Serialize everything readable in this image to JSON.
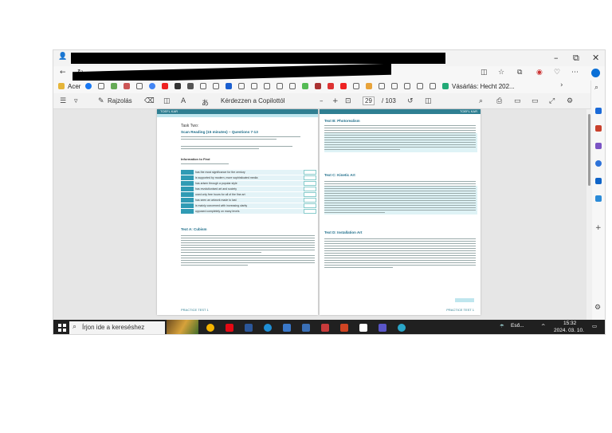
{
  "browser": {
    "bookmarks": {
      "first_label": "Acer",
      "last_label": "Vásárlás: Hecht 202..."
    },
    "pdf_toolbar": {
      "draw_label": "Rajzolás",
      "copilot_placeholder": "Kérdezzen a Copilottól",
      "current_page": "29",
      "total_pages": "/ 103"
    }
  },
  "document": {
    "left_page": {
      "header_tab": "TOEFL KAR",
      "task_title": "Task Two:",
      "subtitle": "Scan Reading (15 minutes) – Questions 7-13",
      "info_heading": "Information to Find",
      "rows": [
        "has the most significance for the century",
        "is supported by modern, more sophisticated media",
        "has arisen through a popular style",
        "has revolutionised art and society",
        "used only free hours for all of the fine art",
        "has seen an artwork made to last",
        "is mainly concerned with increasing clarity",
        "opposed completely on many levels"
      ],
      "text_a_heading": "Text A: Cubism",
      "footer": "PRACTICE TEST 1"
    },
    "right_page": {
      "header_tab": "TOEFL KAR",
      "text_b_heading": "Text B: Photorealism",
      "text_c_heading": "Text C: Kinetic Art",
      "text_d_heading": "Text D: Installation Art",
      "footer": "PRACTICE TEST 1"
    }
  },
  "taskbar": {
    "search_placeholder": "Írjon ide a kereséshez",
    "weather": "Eső...",
    "time": "15:32",
    "date": "2024. 03. 10."
  },
  "colors": {
    "accent": "#2f7f92",
    "taskbar": "#202020",
    "edge_blue": "#0a6fd6"
  }
}
